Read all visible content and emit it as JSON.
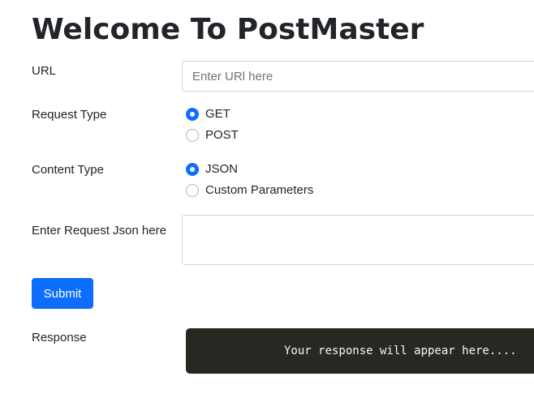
{
  "page": {
    "title": "Welcome To PostMaster"
  },
  "url_field": {
    "label": "URL",
    "placeholder": "Enter URl here",
    "value": ""
  },
  "request_type": {
    "label": "Request Type",
    "options": [
      {
        "label": "GET",
        "checked": true
      },
      {
        "label": "POST",
        "checked": false
      }
    ]
  },
  "content_type": {
    "label": "Content Type",
    "options": [
      {
        "label": "JSON",
        "checked": true
      },
      {
        "label": "Custom Parameters",
        "checked": false
      }
    ]
  },
  "request_json": {
    "label": "Enter Request Json here",
    "value": ""
  },
  "submit": {
    "label": "Submit"
  },
  "response": {
    "label": "Response",
    "text": "Your response will appear here...."
  },
  "colors": {
    "primary": "#0d6efd",
    "response_background": "#272822",
    "response_text": "#f8f8f2"
  }
}
